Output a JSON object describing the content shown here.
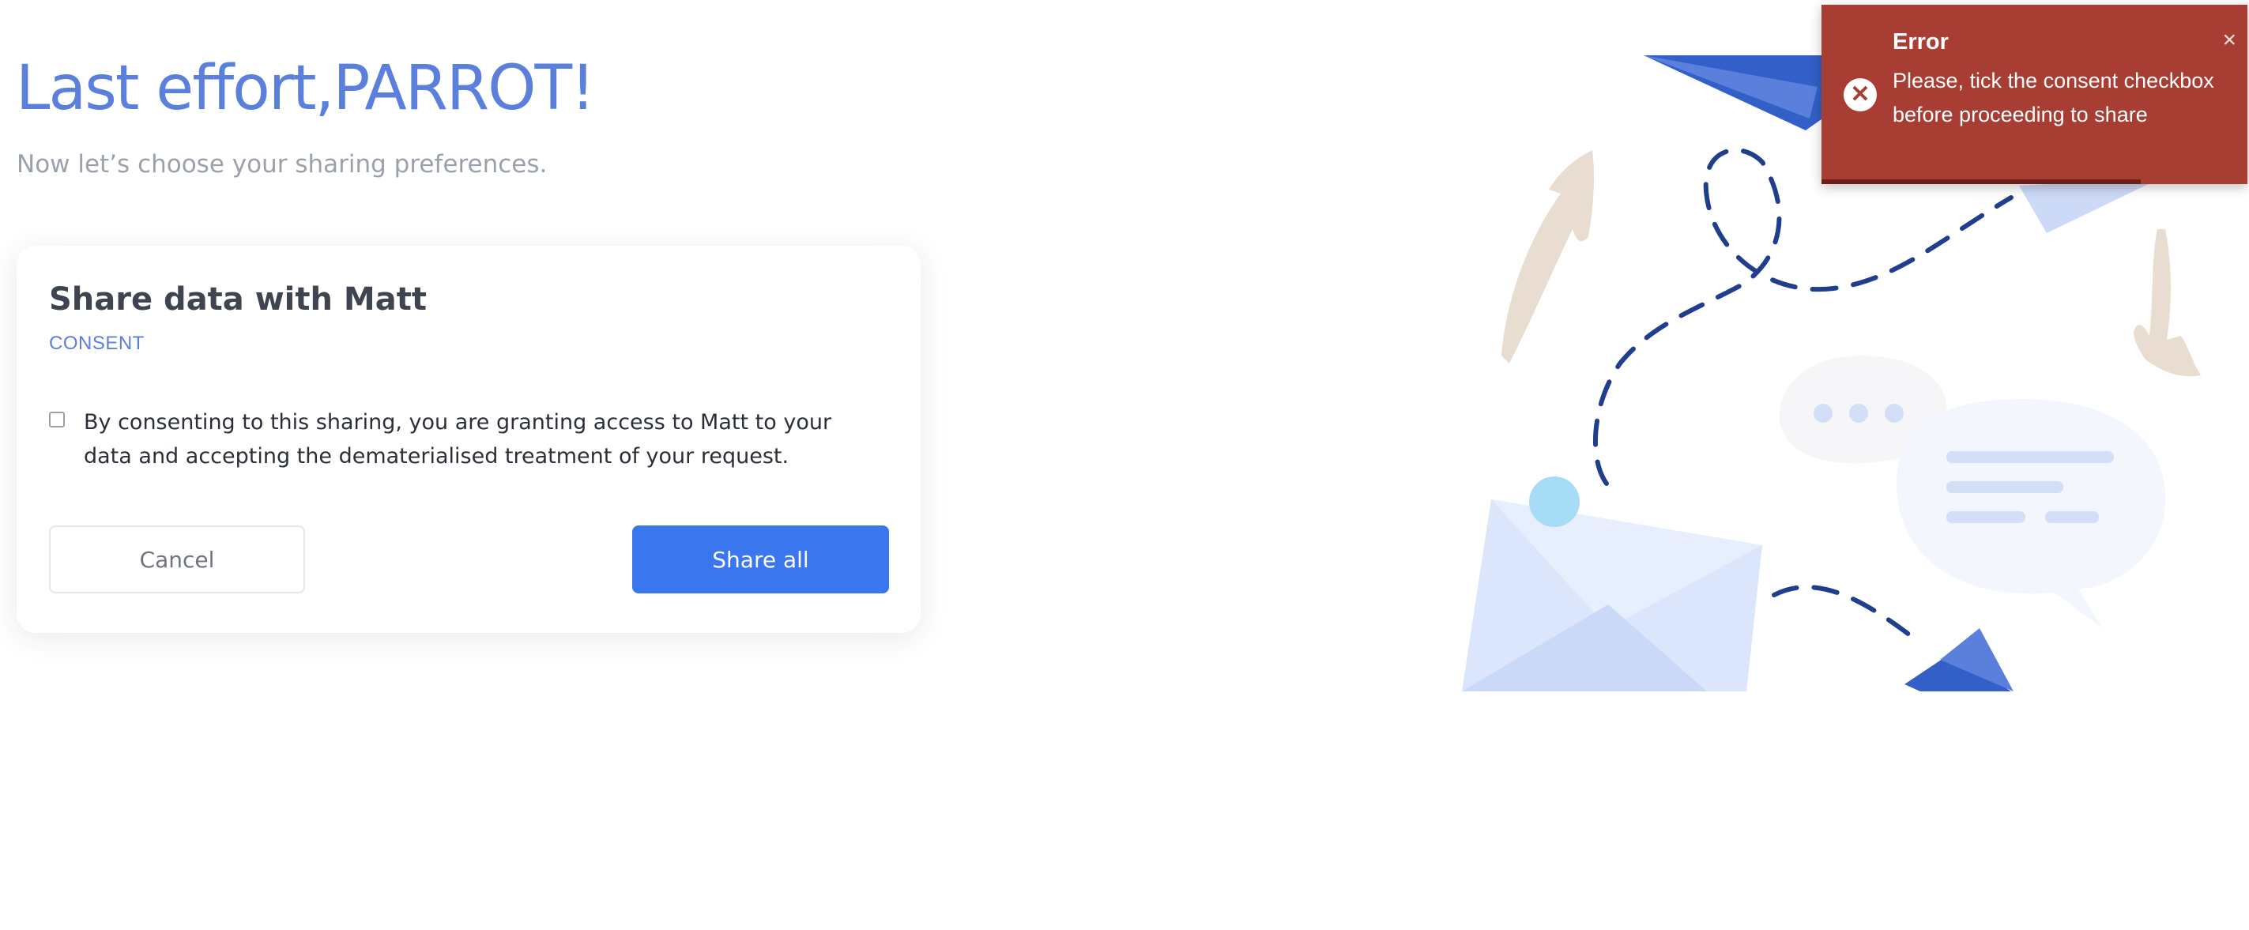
{
  "header": {
    "title": "Last effort,PARROT!",
    "subtitle": "Now let’s choose your sharing preferences."
  },
  "card": {
    "title": "Share data with Matt",
    "subtitle": "CONSENT",
    "consent_text": "By consenting to this sharing, you are granting access to Matt to your data and accepting the dematerialised treatment of your request.",
    "consent_checked": false,
    "cancel_label": "Cancel",
    "share_label": "Share all"
  },
  "toast": {
    "title": "Error",
    "message": "Please, tick the consent checkbox before proceeding to share",
    "close_icon": "close-icon",
    "status_icon": "error-circle-icon",
    "progress": 0.75
  },
  "colors": {
    "accent": "#5b80dc",
    "primary_button": "#3a77ee",
    "error": "#a83d33"
  }
}
